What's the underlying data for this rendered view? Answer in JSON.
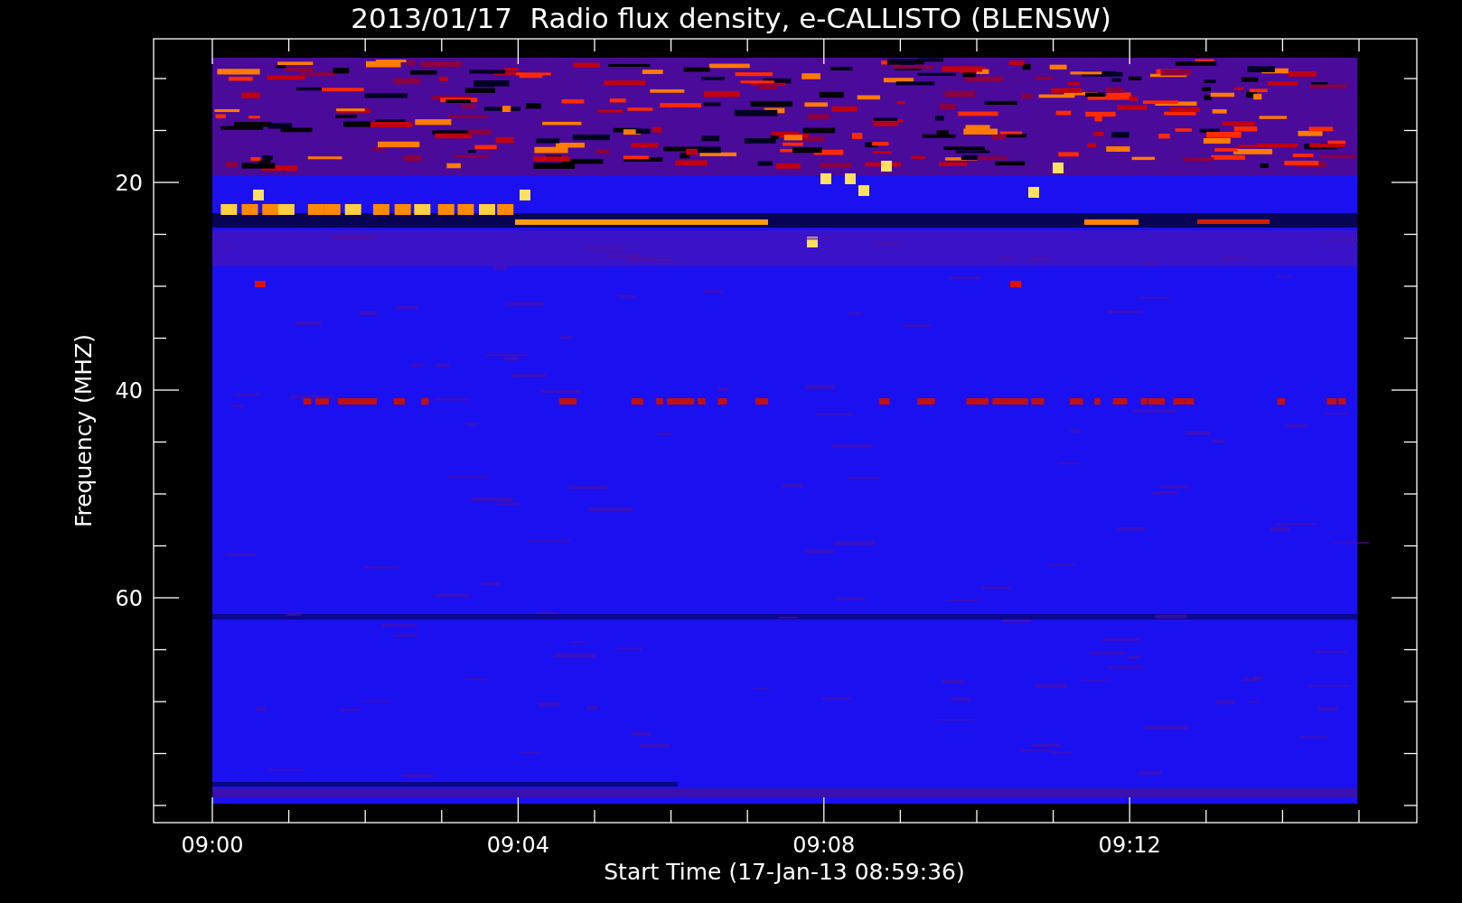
{
  "title": "2013/01/17  Radio flux density, e-CALLISTO (BLENSW)",
  "y_axis": {
    "label": "Frequency (MHZ)",
    "ticks": [
      "20",
      "40",
      "60"
    ]
  },
  "x_axis": {
    "label": "Start Time (17-Jan-13 08:59:36)",
    "ticks": [
      "09:00",
      "09:04",
      "09:08",
      "09:12"
    ]
  }
}
